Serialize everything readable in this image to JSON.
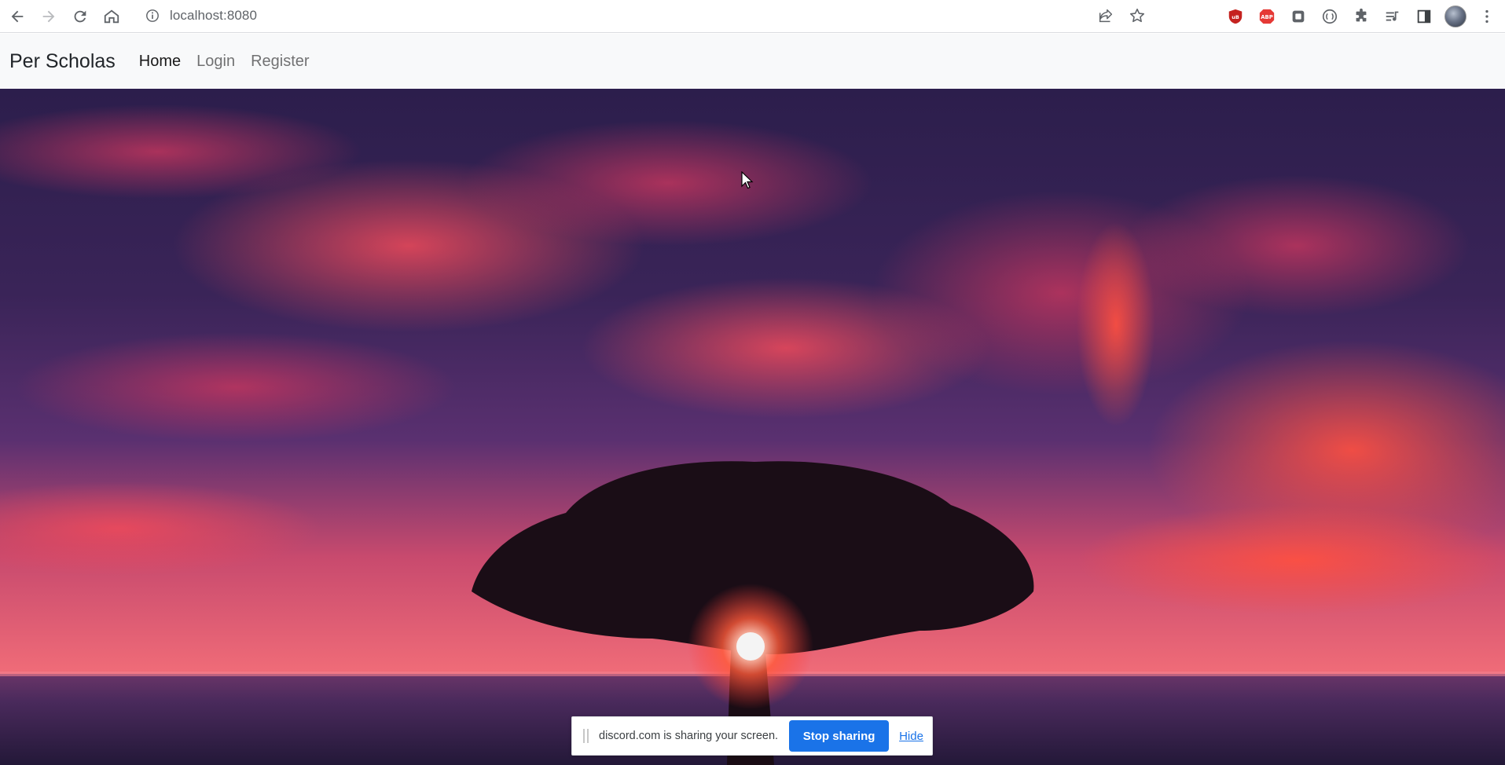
{
  "browser": {
    "url": "localhost:8080",
    "icons": [
      "back-icon",
      "forward-icon",
      "reload-icon",
      "home-icon",
      "info-icon",
      "share-icon",
      "bookmark-star-icon",
      "ublock-icon",
      "adblock-plus-icon",
      "extension-icon",
      "extension-icon",
      "puzzle-icon",
      "media-control-icon",
      "side-panel-icon",
      "profile-avatar",
      "more-menu-icon"
    ],
    "adblock_label": "ABP"
  },
  "site": {
    "brand": "Per Scholas",
    "nav": [
      {
        "label": "Home",
        "active": true
      },
      {
        "label": "Login",
        "active": false
      },
      {
        "label": "Register",
        "active": false
      }
    ]
  },
  "hero": {
    "image": "sunset-tree-over-sea",
    "colors": {
      "sky_top": "#2a1c4a",
      "cloud": "#e0404f",
      "horizon": "#f0506a",
      "sea": "#3a2550"
    }
  },
  "share_banner": {
    "message": "discord.com is sharing your screen.",
    "stop_label": "Stop sharing",
    "hide_label": "Hide",
    "accent": "#1a73e8"
  }
}
